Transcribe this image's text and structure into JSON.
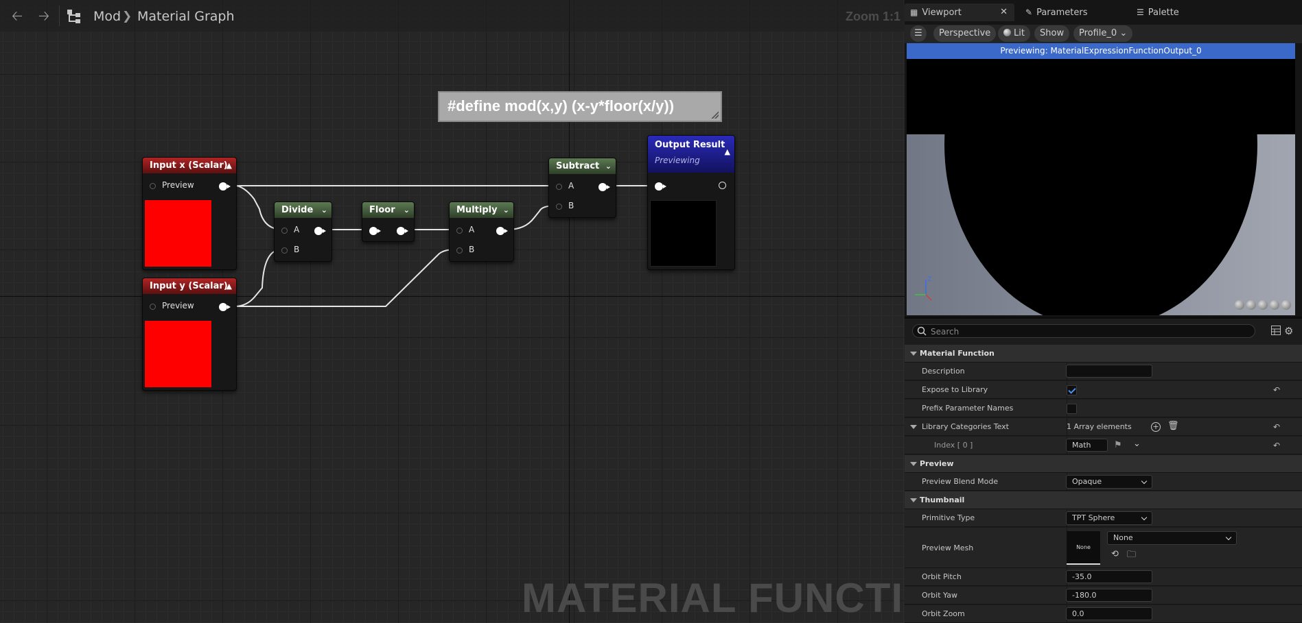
{
  "graph_header": {
    "breadcrumb": [
      "Mod",
      "Material Graph"
    ],
    "zoom": "Zoom 1:1"
  },
  "watermark": "MATERIAL FUNCTION",
  "comment": "#define mod(x,y) (x-y*floor(x/y))",
  "nodes": {
    "input_x": {
      "title": "Input x (Scalar)",
      "pin": "Preview",
      "swatch_color": "#ff0000"
    },
    "input_y": {
      "title": "Input y (Scalar)",
      "pin": "Preview",
      "swatch_color": "#ff0000"
    },
    "divide": {
      "title": "Divide",
      "pins": [
        "A",
        "B"
      ]
    },
    "floor": {
      "title": "Floor"
    },
    "multiply": {
      "title": "Multiply",
      "pins": [
        "A",
        "B"
      ]
    },
    "subtract": {
      "title": "Subtract",
      "pins": [
        "A",
        "B"
      ]
    },
    "output": {
      "title": "Output Result",
      "subtitle": "Previewing",
      "swatch_color": "#000000"
    }
  },
  "tabs": {
    "viewport": "Viewport",
    "parameters": "Parameters",
    "palette": "Palette"
  },
  "viewport_toolbar": {
    "perspective": "Perspective",
    "lit": "Lit",
    "show": "Show",
    "profile": "Profile_0"
  },
  "viewport_banner": "Previewing: MaterialExpressionFunctionOutput_0",
  "details": {
    "search_placeholder": "Search",
    "material_function": {
      "header": "Material Function",
      "description_label": "Description",
      "description_value": "",
      "expose_label": "Expose to Library",
      "expose_checked": true,
      "prefix_label": "Prefix Parameter Names",
      "prefix_checked": false,
      "library_categories_label": "Library Categories Text",
      "library_categories_value": "1 Array elements",
      "index_label": "Index [ 0 ]",
      "index_value": "Math"
    },
    "preview": {
      "header": "Preview",
      "blend_mode_label": "Preview Blend Mode",
      "blend_mode_value": "Opaque"
    },
    "thumbnail": {
      "header": "Thumbnail",
      "primitive_type_label": "Primitive Type",
      "primitive_type_value": "TPT Sphere",
      "preview_mesh_label": "Preview Mesh",
      "preview_mesh_thumb": "None",
      "preview_mesh_value": "None",
      "orbit_pitch_label": "Orbit Pitch",
      "orbit_pitch_value": "-35.0",
      "orbit_yaw_label": "Orbit Yaw",
      "orbit_yaw_value": "-180.0",
      "orbit_zoom_label": "Orbit Zoom",
      "orbit_zoom_value": "0.0"
    }
  }
}
